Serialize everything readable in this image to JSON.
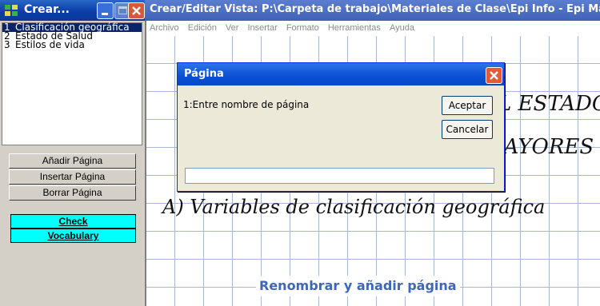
{
  "left_window": {
    "title": "Crear...",
    "pages": [
      {
        "num": "1",
        "label": "Clasificación geográfica",
        "selected": true
      },
      {
        "num": "2",
        "label": "Estado de Salud",
        "selected": false
      },
      {
        "num": "3",
        "label": "Estilos de vida",
        "selected": false
      }
    ],
    "buttons": {
      "add_page": "Añadir Página",
      "insert_page": "Insertar Página",
      "delete_page": "Borrar Página",
      "check": "Check",
      "vocabulary": "Vocabulary"
    }
  },
  "main_window": {
    "title": "Crear/Editar Vista: P:\\Carpeta de trabajo\\Materiales de Clase\\Epi Info - Epi Map\\",
    "menu": [
      "Archivo",
      "Edición",
      "Ver",
      "Insertar",
      "Formato",
      "Herramientas",
      "Ayuda"
    ],
    "canvas": {
      "heading_1": "EL ESTADO",
      "heading_2": "MAYORES",
      "heading_3": "A) Variables de clasificación geográfica",
      "caption": "Renombrar y añadir página"
    }
  },
  "dialog": {
    "title": "Página",
    "prompt": "1:Entre nombre de página",
    "ok": "Aceptar",
    "cancel": "Cancelar",
    "input_value": ""
  },
  "colors": {
    "selection": "#0a246a",
    "cyan_button": "#00ffff",
    "caption_text": "#3f66b8",
    "xp_title_blue": "#0b4fd6"
  }
}
